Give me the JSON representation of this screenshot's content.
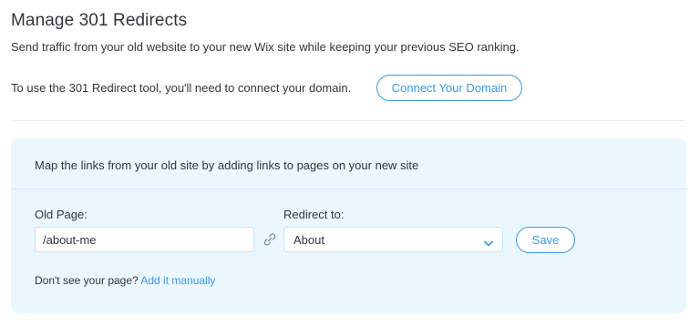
{
  "header": {
    "title": "Manage 301 Redirects",
    "subtitle": "Send traffic from your old website to your new Wix site while keeping your previous SEO ranking."
  },
  "connect": {
    "text": "To use the 301 Redirect tool, you'll need to connect your domain.",
    "button_label": "Connect Your Domain"
  },
  "mapping": {
    "header": "Map the links from your old site by adding links to pages on your new site",
    "old_page_label": "Old Page:",
    "old_page_value": "/about-me",
    "redirect_label": "Redirect to:",
    "redirect_selected": "About",
    "save_label": "Save",
    "help_text": "Don't see your page?",
    "help_link": "Add it manually"
  },
  "icons": {
    "link": "link-icon",
    "chevron": "chevron-down-icon"
  },
  "colors": {
    "accent": "#3899ec",
    "panel_background": "#eaf7ff",
    "text": "#32363b",
    "input_border": "#c1e4fe"
  }
}
